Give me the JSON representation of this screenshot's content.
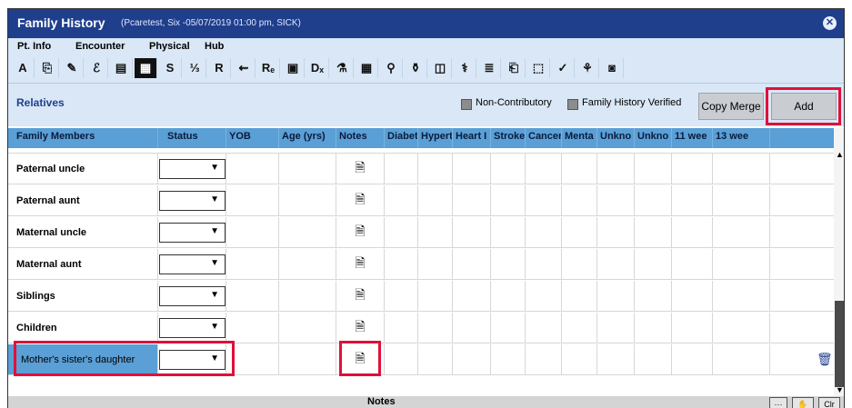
{
  "window": {
    "title": "Family History",
    "subtitle": "(Pcaretest, Six -05/07/2019 01:00 pm, SICK)",
    "close_icon": "close-icon"
  },
  "menu": [
    "Pt. Info",
    "Encounter",
    "Physical",
    "Hub"
  ],
  "toolbar_icons": [
    {
      "glyph": "A",
      "name": "allergy-icon"
    },
    {
      "glyph": "⎘",
      "name": "clipboard-icon"
    },
    {
      "glyph": "✎",
      "name": "pen-icon"
    },
    {
      "glyph": "ℰ",
      "name": "script-icon"
    },
    {
      "glyph": "▤",
      "name": "notes-icon"
    },
    {
      "glyph": "▦",
      "name": "family-history-icon"
    },
    {
      "glyph": "S",
      "name": "social-history-icon"
    },
    {
      "glyph": "⅓",
      "name": "medication-icon"
    },
    {
      "glyph": "R",
      "name": "review-icon"
    },
    {
      "glyph": "⇜",
      "name": "physical-exam-icon"
    },
    {
      "glyph": "Rₑ",
      "name": "rx-icon"
    },
    {
      "glyph": "▣",
      "name": "document-icon"
    },
    {
      "glyph": "Dₓ",
      "name": "diagnosis-icon"
    },
    {
      "glyph": "⚗",
      "name": "lab-icon"
    },
    {
      "glyph": "▦",
      "name": "grid-icon"
    },
    {
      "glyph": "⚲",
      "name": "test-icon"
    },
    {
      "glyph": "⚱",
      "name": "procedure-icon"
    },
    {
      "glyph": "◫",
      "name": "form-icon"
    },
    {
      "glyph": "⚕",
      "name": "injection-icon"
    },
    {
      "glyph": "≣",
      "name": "list-icon"
    },
    {
      "glyph": "⎗",
      "name": "print-icon"
    },
    {
      "glyph": "⬚",
      "name": "referral-icon"
    },
    {
      "glyph": "✓",
      "name": "check-icon"
    },
    {
      "glyph": "⚘",
      "name": "care-plan-icon"
    },
    {
      "glyph": "◙",
      "name": "cow-icon"
    }
  ],
  "relatives": {
    "title": "Relatives",
    "non_contributory": "Non-Contributory",
    "family_history_verified": "Family History Verified",
    "copy_merge": "Copy Merge",
    "add": "Add"
  },
  "columns": [
    "Family Members",
    "Status",
    "YOB",
    "Age (yrs)",
    "Notes",
    "Diabet",
    "Hypert",
    "Heart I",
    "Stroke",
    "Cancer",
    "Menta",
    "Unkno",
    "Unkno",
    "11 wee",
    "13 wee"
  ],
  "rows": [
    {
      "name": "Paternal uncle",
      "status": ""
    },
    {
      "name": "Paternal aunt",
      "status": ""
    },
    {
      "name": "Maternal uncle",
      "status": ""
    },
    {
      "name": "Maternal aunt",
      "status": ""
    },
    {
      "name": "Siblings",
      "status": ""
    },
    {
      "name": "Children",
      "status": ""
    },
    {
      "name": "Mother's sister's daughter",
      "status": ""
    }
  ],
  "footer": {
    "label": "Notes",
    "more": "···",
    "hand": "✋",
    "clear": "Clr"
  },
  "colors": {
    "title_bar": "#1f3f8c",
    "header": "#5a9fd6",
    "highlight": "#e0103a",
    "selected_row": "#5a9fd6"
  }
}
